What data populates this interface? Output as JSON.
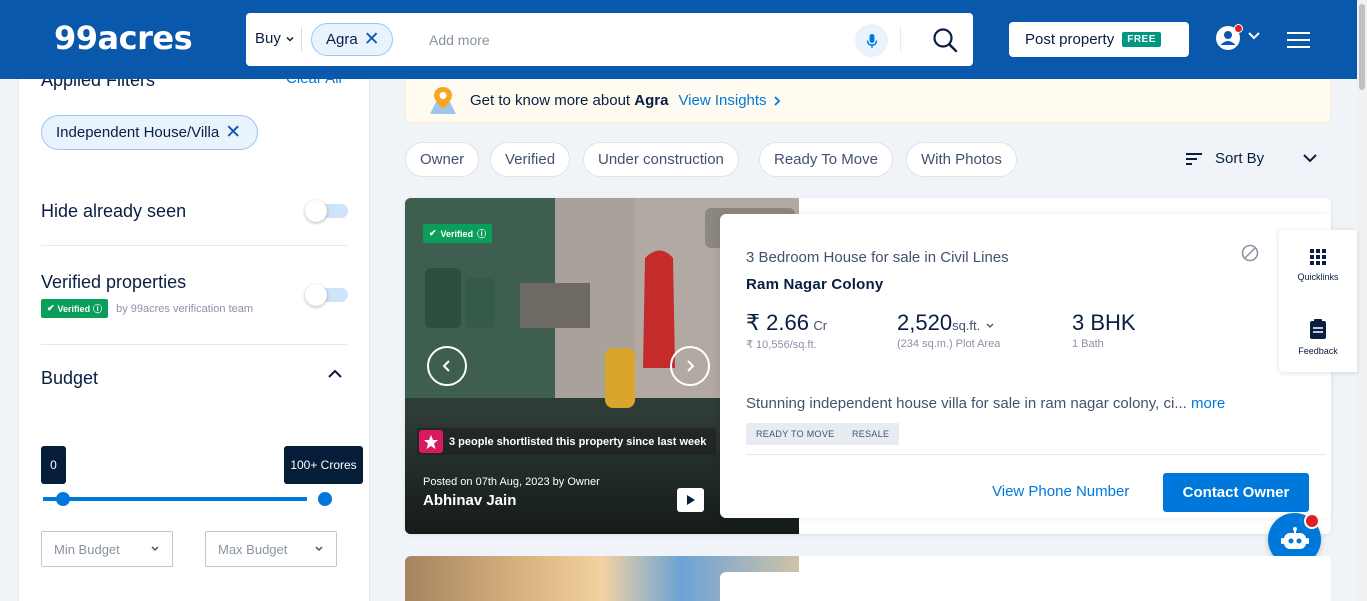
{
  "header": {
    "logo": "99acres",
    "search": {
      "buy_label": "Buy",
      "city_chip": "Agra",
      "placeholder": "Add more"
    },
    "post_property": {
      "label": "Post property",
      "badge": "FREE"
    }
  },
  "filters": {
    "title": "Applied Filters",
    "clear_all": "Clear All",
    "chips": [
      "Independent House/Villa"
    ],
    "hide_seen": "Hide already seen",
    "verified_properties": "Verified properties",
    "verified_badge": "Verified",
    "verified_by": "by 99acres verification team",
    "budget": {
      "title": "Budget",
      "min_bubble": "0",
      "max_bubble": "100+ Crores",
      "min_select": "Min Budget",
      "max_select": "Max Budget"
    }
  },
  "insights": {
    "prefix": "Get to know more about",
    "city": "Agra",
    "link": "View Insights"
  },
  "quick_filters": [
    "Owner",
    "Verified",
    "Under construction",
    "Ready To Move",
    "With Photos"
  ],
  "sort": {
    "label": "Sort By"
  },
  "listing": {
    "verified_badge": "Verified",
    "shortlist_text": "3 people shortlisted this property since last week",
    "posted_on": "Posted on 07th Aug, 2023 by Owner",
    "poster": "Abhinav Jain",
    "subtitle": "3 Bedroom House for sale in Civil Lines",
    "title": "Ram Nagar Colony",
    "price": {
      "main": "₹ 2.66",
      "unit": "Cr",
      "sub": "₹ 10,556/sq.ft."
    },
    "area": {
      "main": "2,520",
      "unit": "sq.ft.",
      "sub": "(234 sq.m.) Plot Area"
    },
    "config": {
      "main": "3 BHK",
      "sub": "1 Bath"
    },
    "description": "Stunning independent house villa for sale in ram nagar colony, ci...",
    "more": "more",
    "tags": [
      "READY TO MOVE",
      "RESALE"
    ],
    "view_phone": "View Phone Number",
    "contact": "Contact Owner"
  },
  "side_panel": {
    "quicklinks": "Quicklinks",
    "feedback": "Feedback"
  },
  "colors": {
    "header_bg": "#0a58ab",
    "accent": "#0078db",
    "verified_green": "#0a9e5b",
    "free_badge": "#009681"
  }
}
